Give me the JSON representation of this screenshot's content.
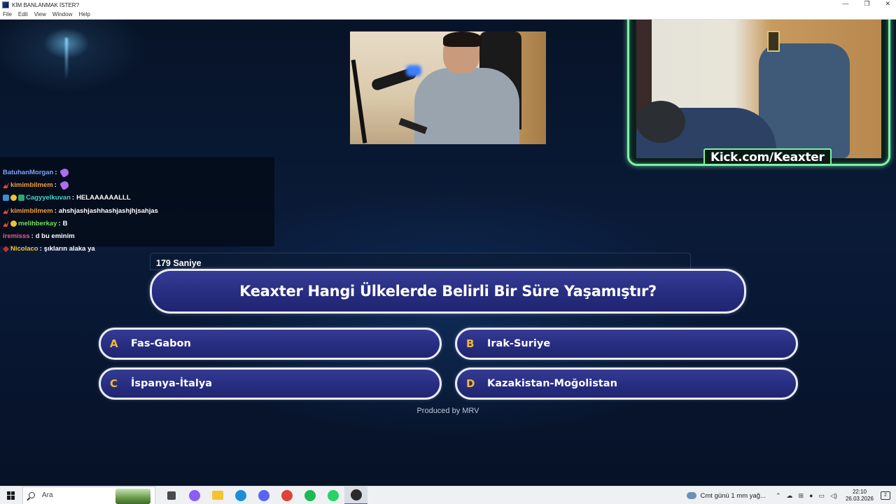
{
  "window": {
    "title": "KİM BANLANMAK İSTER?",
    "controls": {
      "minimize": "—",
      "maximize": "❐",
      "close": "✕"
    }
  },
  "menu": [
    "File",
    "Edit",
    "View",
    "Window",
    "Help"
  ],
  "stream": {
    "overlay_label": "Kick.com/Keaxter",
    "accent_color": "#7cf3a6"
  },
  "chat": {
    "messages": [
      {
        "user": "BatuhanMorgan",
        "user_color": "#7aa6f5",
        "badges": [],
        "text": "",
        "emote": "emote-icon"
      },
      {
        "user": "kimimbilmem",
        "user_color": "#f2a03b",
        "badges": [
          "kick"
        ],
        "text": "",
        "emote": "emote-icon"
      },
      {
        "user": "Cagyyelkuvan",
        "user_color": "#46d4c7",
        "badges": [
          "mod",
          "sub",
          "vip"
        ],
        "text": "HELAAAAAALLL",
        "emote": ""
      },
      {
        "user": "kimimbilmem",
        "user_color": "#f2a03b",
        "badges": [
          "kick"
        ],
        "text": "ahshjashjashhashjashjhjsahjas",
        "emote": ""
      },
      {
        "user": "melihberkay",
        "user_color": "#6fe05a",
        "badges": [
          "kick",
          "sub"
        ],
        "text": "B",
        "emote": ""
      },
      {
        "user": "iremisss",
        "user_color": "#ea5d8c",
        "badges": [],
        "text": "d bu eminim",
        "emote": ""
      },
      {
        "user": "Nicolaco",
        "user_color": "#f2c233",
        "badges": [
          "red"
        ],
        "text": "şıkların alaka ya",
        "emote": ""
      }
    ]
  },
  "quiz": {
    "timer": "179 Saniye",
    "question": "Keaxter Hangi Ülkelerde Belirli Bir Süre Yaşamıştır?",
    "answers": [
      {
        "letter": "A",
        "text": "Fas-Gabon"
      },
      {
        "letter": "B",
        "text": "Irak-Suriye"
      },
      {
        "letter": "C",
        "text": "İspanya-İtalya"
      },
      {
        "letter": "D",
        "text": "Kazakistan-Moğolistan"
      }
    ],
    "answer_letter_color": "#f1b838",
    "credit": "Produced by MRV"
  },
  "taskbar": {
    "search_placeholder": "Ara",
    "weather": "Cmt günü 1 mm yağ...",
    "time": "22:10",
    "date": "26.03.2026",
    "notification_count": "2",
    "apps": [
      {
        "name": "task-view-icon",
        "color": "#4a4a4a"
      },
      {
        "name": "copilot-icon",
        "color": "#8b5cf6"
      },
      {
        "name": "file-explorer-icon",
        "color": "#f4c430"
      },
      {
        "name": "edge-icon",
        "color": "#1b8fd6"
      },
      {
        "name": "discord-icon",
        "color": "#5865f2"
      },
      {
        "name": "chrome-icon",
        "color": "#db4437"
      },
      {
        "name": "spotify-icon",
        "color": "#1db954"
      },
      {
        "name": "whatsapp-icon",
        "color": "#25d366"
      },
      {
        "name": "obs-icon",
        "color": "#2a2a2a"
      }
    ]
  }
}
